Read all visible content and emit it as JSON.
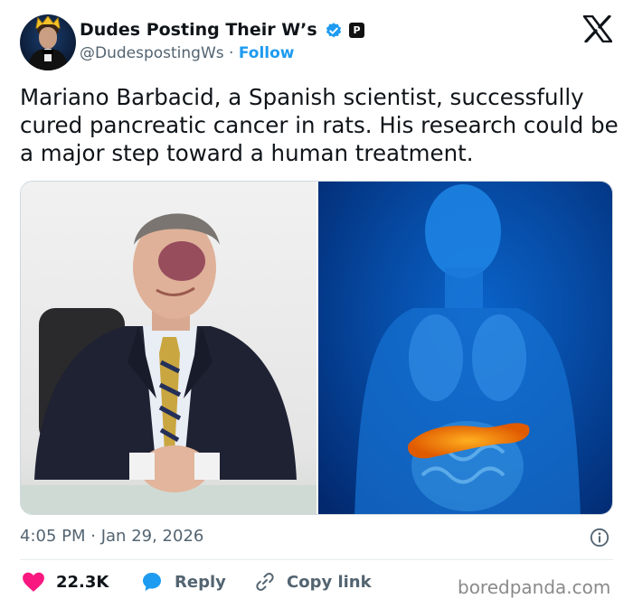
{
  "author": {
    "display_name": "Dudes Posting Their W’s",
    "handle": "@DudespostingWs",
    "follow_label": "Follow"
  },
  "tweet": {
    "text": "Mariano Barbacid, a Spanish scientist, successfully cured pancreatic cancer in rats. His research could be a major step toward a human treatment."
  },
  "meta": {
    "time": "4:05 PM",
    "date": "Jan 29, 2026"
  },
  "actions": {
    "likes": "22.3K",
    "reply_label": "Reply",
    "copy_label": "Copy link"
  },
  "watermark": "boredpanda.com",
  "colors": {
    "accent": "#1d9bf0",
    "like": "#f91880",
    "muted": "#536471"
  },
  "icons": {
    "verified": "verified-badge-icon",
    "affiliate": "affiliate-badge-icon",
    "platform": "x-logo-icon",
    "info": "info-icon",
    "like": "heart-icon",
    "reply": "reply-bubble-icon",
    "copy": "link-icon"
  }
}
